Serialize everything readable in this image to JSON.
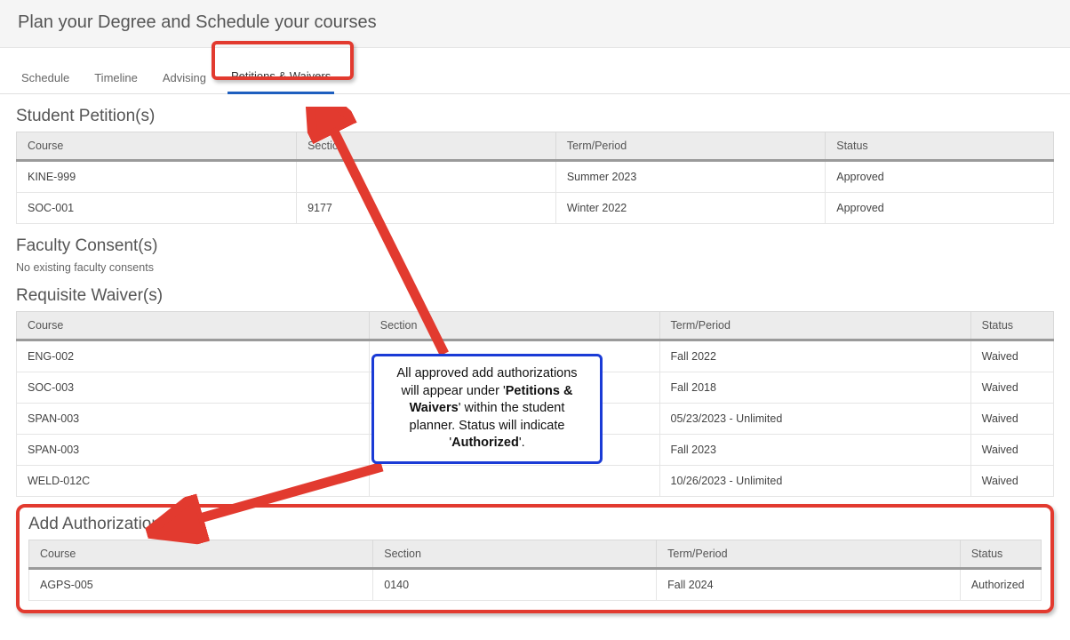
{
  "header": {
    "title": "Plan your Degree and Schedule your courses"
  },
  "tabs": {
    "schedule": "Schedule",
    "timeline": "Timeline",
    "advising": "Advising",
    "petitions": "Petitions & Waivers"
  },
  "petitions": {
    "title": "Student Petition(s)",
    "columns": {
      "course": "Course",
      "section": "Section",
      "term": "Term/Period",
      "status": "Status"
    },
    "rows": [
      {
        "course": "KINE-999",
        "section": "",
        "term": "Summer 2023",
        "status": "Approved"
      },
      {
        "course": "SOC-001",
        "section": "9177",
        "term": "Winter 2022",
        "status": "Approved"
      }
    ]
  },
  "faculty_consent": {
    "title": "Faculty Consent(s)",
    "empty": "No existing faculty consents"
  },
  "requisite": {
    "title": "Requisite Waiver(s)",
    "columns": {
      "course": "Course",
      "section": "Section",
      "term": "Term/Period",
      "status": "Status"
    },
    "rows": [
      {
        "course": "ENG-002",
        "section": "",
        "term": "Fall 2022",
        "status": "Waived"
      },
      {
        "course": "SOC-003",
        "section": "",
        "term": "Fall 2018",
        "status": "Waived"
      },
      {
        "course": "SPAN-003",
        "section": "",
        "term": "05/23/2023 - Unlimited",
        "status": "Waived"
      },
      {
        "course": "SPAN-003",
        "section": "",
        "term": "Fall 2023",
        "status": "Waived"
      },
      {
        "course": "WELD-012C",
        "section": "",
        "term": "10/26/2023 - Unlimited",
        "status": "Waived"
      }
    ]
  },
  "add_auth": {
    "title": "Add Authorization(s)",
    "columns": {
      "course": "Course",
      "section": "Section",
      "term": "Term/Period",
      "status": "Status"
    },
    "rows": [
      {
        "course": "AGPS-005",
        "section": "0140",
        "term": "Fall 2024",
        "status": "Authorized"
      }
    ]
  },
  "callout": {
    "line1": "All approved add authorizations will appear under '",
    "strong1": "Petitions & Waivers",
    "line2": "' within the student planner. Status will indicate '",
    "strong2": "Authorized",
    "line3": "'."
  }
}
